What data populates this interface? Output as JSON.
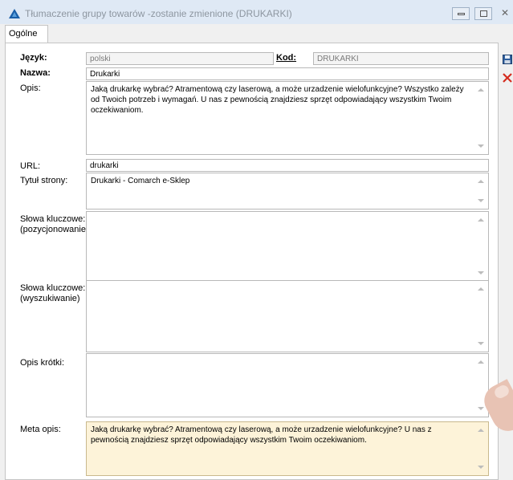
{
  "window": {
    "title": "Tłumaczenie grupy towarów -zostanie zmienione (DRUKARKI)",
    "close_glyph": "✕"
  },
  "tabs": [
    {
      "label": "Ogólne",
      "active": true
    }
  ],
  "form": {
    "jezyk_label": "Język:",
    "jezyk_value": "polski",
    "kod_label": "Kod:",
    "kod_value": "DRUKARKI",
    "nazwa_label": "Nazwa:",
    "nazwa_value": "Drukarki",
    "opis_label": "Opis:",
    "opis_value": "Jaką drukarkę wybrać? Atramentową czy laserową, a może urzadzenie wielofunkcyjne? Wszystko zależy od Twoich potrzeb i wymagań. U nas z pewnością znajdziesz sprzęt odpowiadający wszystkim Twoim oczekiwaniom.",
    "url_label": "URL:",
    "url_value": "drukarki",
    "tytul_label": "Tytuł strony:",
    "tytul_value": "Drukarki - Comarch e-Sklep",
    "slowa_poz_label_1": "Słowa kluczowe:",
    "slowa_poz_label_2": "(pozycjonowanie)",
    "slowa_poz_value": "",
    "slowa_wysz_label_1": "Słowa kluczowe:",
    "slowa_wysz_label_2": "(wyszukiwanie)",
    "slowa_wysz_value": "",
    "opis_krotki_label": "Opis krótki:",
    "opis_krotki_value": "",
    "meta_label": "Meta opis:",
    "meta_value": "Jaką drukarkę wybrać? Atramentową czy laserową, a może urzadzenie wielofunkcyjne? U nas z pewnością znajdziesz sprzęt odpowiadający wszystkim Twoim oczekiwaniom."
  },
  "side_buttons": [
    {
      "icon": "save-icon",
      "color": "#2f5f9e"
    },
    {
      "icon": "cancel-x-icon",
      "color": "#d42b1e"
    }
  ],
  "colors": {
    "accent": "#1a5fa8",
    "meta_bg": "#fdf3d9",
    "titlebar": "#dfe9f5"
  }
}
